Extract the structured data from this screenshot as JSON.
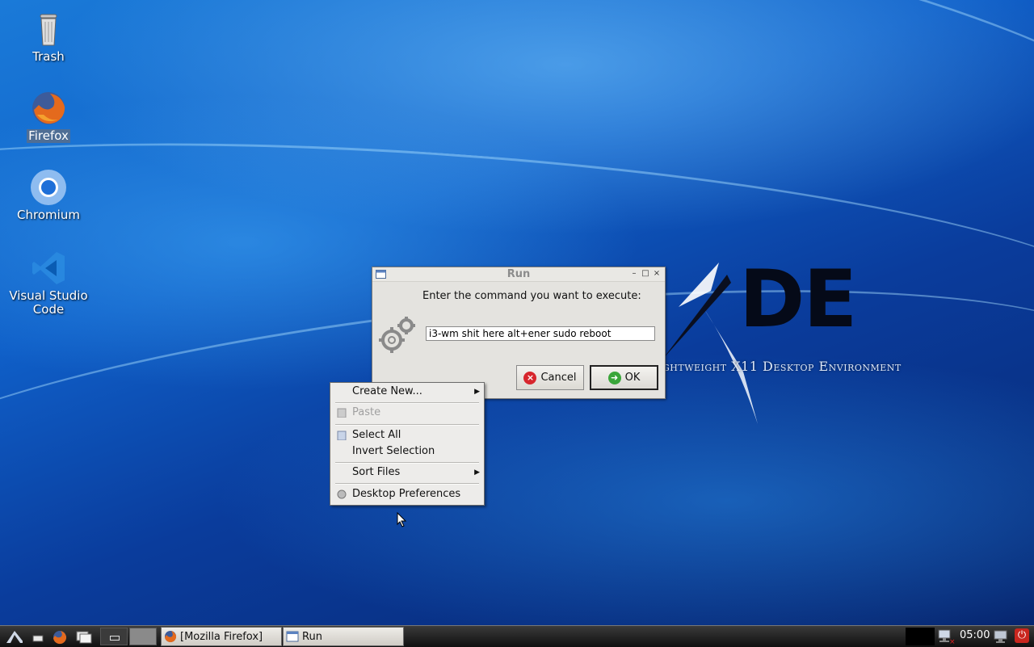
{
  "desktop": {
    "icons": [
      {
        "label": "Trash"
      },
      {
        "label": "Firefox"
      },
      {
        "label": "Chromium"
      },
      {
        "label": "Visual Studio Code"
      }
    ],
    "wallpaper": {
      "logo_text": "DE",
      "tagline": "ghtweight X11 Desktop Environment"
    }
  },
  "run_dialog": {
    "title": "Run",
    "prompt": "Enter the command you want to execute:",
    "command_value": "i3-wm shit here alt+ener sudo reboot",
    "cancel_label": "Cancel",
    "ok_label": "OK"
  },
  "context_menu": {
    "items": [
      {
        "label": "Create New...",
        "submenu": true
      },
      {
        "label": "Paste",
        "disabled": true
      },
      {
        "label": "Select All"
      },
      {
        "label": "Invert Selection"
      },
      {
        "label": "Sort Files",
        "submenu": true
      },
      {
        "label": "Desktop Preferences"
      }
    ]
  },
  "taskbar": {
    "tasks": [
      {
        "label": "[Mozilla Firefox]"
      },
      {
        "label": "Run"
      }
    ],
    "clock": "05:00"
  },
  "colors": {
    "wallpaper_blue": "#0f5fc8",
    "taskbar": "#1a1a1a",
    "cancel_red": "#d7262d",
    "ok_green": "#3aa63a"
  }
}
